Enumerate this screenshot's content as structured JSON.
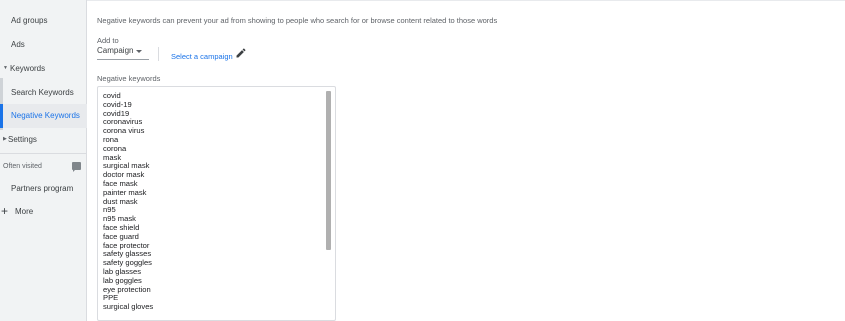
{
  "sidebar": {
    "items": [
      {
        "label": "Ad groups"
      },
      {
        "label": "Ads"
      },
      {
        "label": "Keywords"
      },
      {
        "label": "Search Keywords"
      },
      {
        "label": "Negative Keywords"
      },
      {
        "label": "Settings"
      },
      {
        "label": "Partners program"
      },
      {
        "label": "More"
      }
    ],
    "often_visited": "Often visited"
  },
  "main": {
    "description": "Negative keywords can prevent your ad from showing to people who search for or browse content related to those words",
    "add_to_label": "Add to",
    "add_to_value": "Campaign",
    "select_campaign": "Select a campaign",
    "negative_keywords_label": "Negative keywords",
    "keywords": [
      "covid",
      "covid-19",
      "covid19",
      "coronavirus",
      "corona virus",
      "rona",
      "corona",
      "mask",
      "surgical mask",
      "doctor mask",
      "face mask",
      "painter mask",
      "dust mask",
      "n95",
      "n95 mask",
      "face shield",
      "face guard",
      "face protector",
      "safety glasses",
      "safety goggles",
      "lab glasses",
      "lab goggles",
      "eye protection",
      "PPE",
      "surgical gloves"
    ]
  },
  "colors": {
    "accent": "#1a73e8",
    "sidebar_bg": "#f1f3f4"
  }
}
